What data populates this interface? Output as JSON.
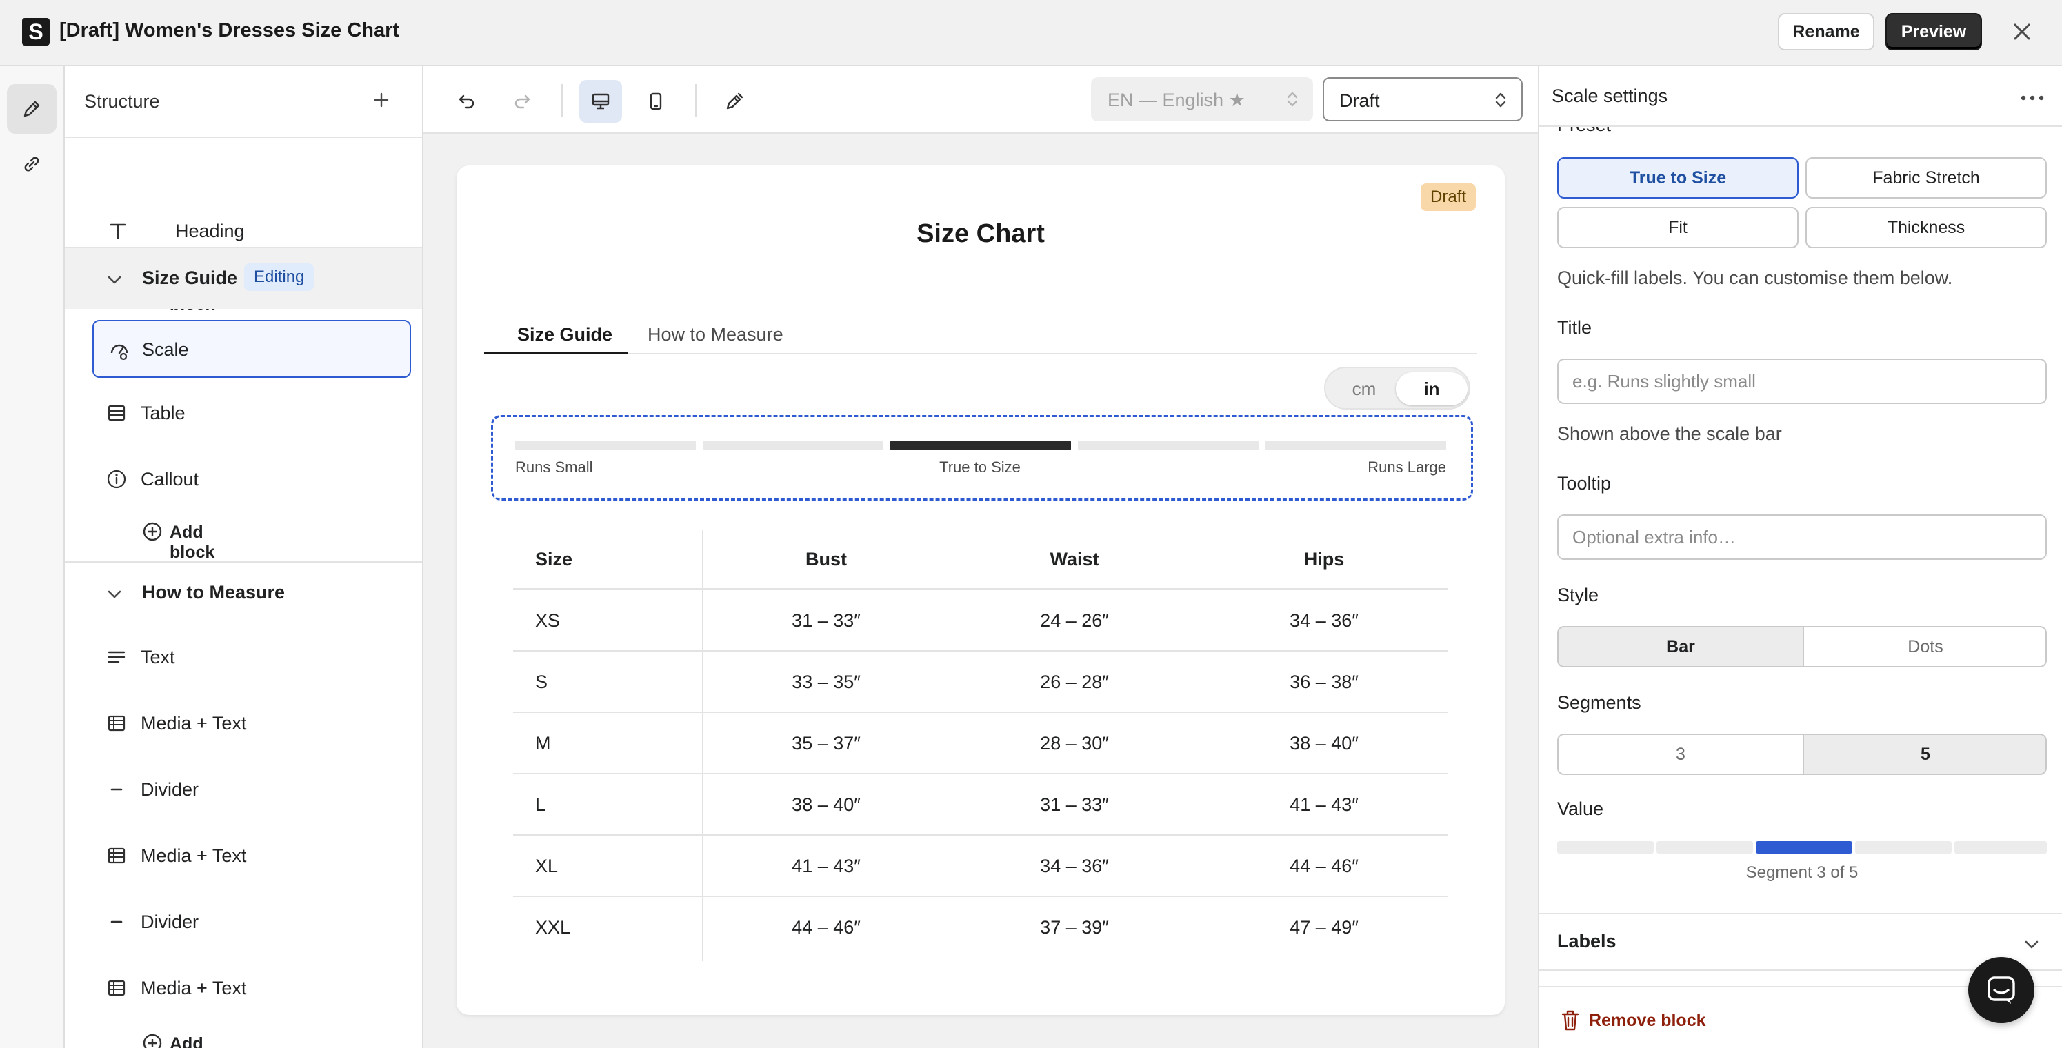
{
  "app": {
    "logo_letter": "S",
    "title": "[Draft] Women's Dresses Size Chart",
    "rename_label": "Rename",
    "preview_label": "Preview"
  },
  "structure": {
    "title": "Structure",
    "heading_item": "Heading",
    "add_block": "Add block",
    "size_guide_section": "Size Guide",
    "editing_badge": "Editing",
    "size_guide_items": [
      "Scale",
      "Table",
      "Callout"
    ],
    "how_to_section": "How to Measure",
    "how_to_items": [
      "Text",
      "Media + Text",
      "Divider",
      "Media + Text",
      "Divider",
      "Media + Text"
    ]
  },
  "toolbar": {
    "language": "EN — English ★",
    "status": "Draft"
  },
  "preview": {
    "draft_badge": "Draft",
    "title": "Size Chart",
    "tabs": [
      "Size Guide",
      "How to Measure"
    ],
    "units": [
      "cm",
      "in"
    ],
    "active_unit": "in",
    "scale": {
      "segments": 5,
      "active_segment": 3,
      "labels": [
        "Runs Small",
        "True to Size",
        "Runs Large"
      ]
    },
    "table": {
      "headers": [
        "Size",
        "Bust",
        "Waist",
        "Hips"
      ],
      "rows": [
        [
          "XS",
          "31 – 33″",
          "24 – 26″",
          "34 – 36″"
        ],
        [
          "S",
          "33 – 35″",
          "26 – 28″",
          "36 – 38″"
        ],
        [
          "M",
          "35 – 37″",
          "28 – 30″",
          "38 – 40″"
        ],
        [
          "L",
          "38 – 40″",
          "31 – 33″",
          "41 – 43″"
        ],
        [
          "XL",
          "41 – 43″",
          "34 – 36″",
          "44 – 46″"
        ],
        [
          "XXL",
          "44 – 46″",
          "37 – 39″",
          "47 – 49″"
        ]
      ]
    }
  },
  "settings": {
    "title": "Scale settings",
    "preset_label": "Preset",
    "presets": [
      "True to Size",
      "Fabric Stretch",
      "Fit",
      "Thickness"
    ],
    "selected_preset": "True to Size",
    "preset_help": "Quick-fill labels. You can customise them below.",
    "title_label": "Title",
    "title_placeholder": "e.g. Runs slightly small",
    "title_help": "Shown above the scale bar",
    "tooltip_label": "Tooltip",
    "tooltip_placeholder": "Optional extra info…",
    "style_label": "Style",
    "style_options": [
      "Bar",
      "Dots"
    ],
    "style_selected": "Bar",
    "segments_label": "Segments",
    "segments_options": [
      "3",
      "5"
    ],
    "segments_selected": "5",
    "value_label": "Value",
    "value_segment": 3,
    "value_total": 5,
    "value_caption": "Segment 3 of 5",
    "labels_section": "Labels",
    "remove_label": "Remove block"
  },
  "colors": {
    "accent": "#2e5bd1",
    "draft_badge": "#f8d8a8",
    "remove": "#8e1f0b"
  }
}
